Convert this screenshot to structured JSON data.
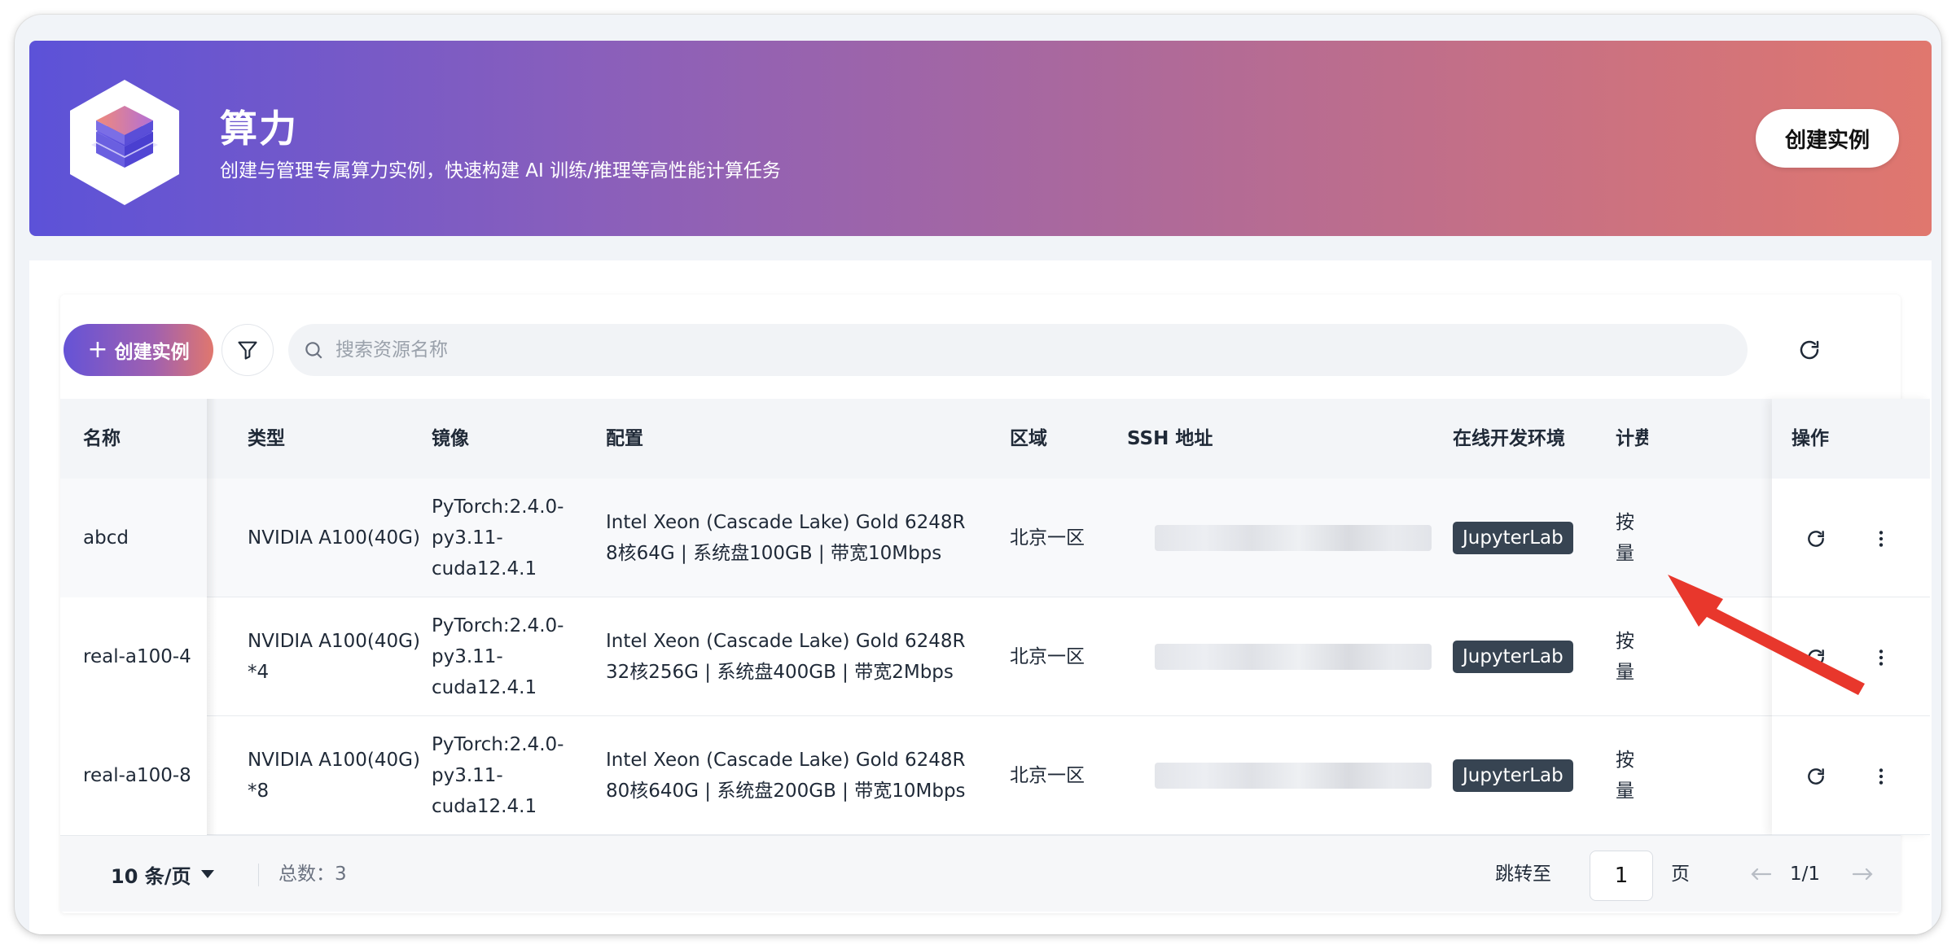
{
  "banner": {
    "title": "算力",
    "subtitle": "创建与管理专属算力实例，快速构建 AI 训练/推理等高性能计算任务",
    "create_button": "创建实例",
    "logo_icon": "server-stack-icon"
  },
  "toolbar": {
    "create_button": "创建实例",
    "search_placeholder": "搜索资源名称",
    "icons": [
      "plus-icon",
      "filter-icon",
      "search-icon",
      "refresh-icon"
    ]
  },
  "table": {
    "columns": [
      "名称",
      "类型",
      "镜像",
      "配置",
      "区域",
      "SSH 地址",
      "在线开发环境",
      "计费",
      "操作"
    ],
    "rows": [
      {
        "name": "abcd",
        "type": "NVIDIA A100(40G)",
        "image": [
          "PyTorch:2.4.0-",
          "py3.11-",
          "cuda12.4.1"
        ],
        "config": [
          "Intel Xeon (Cascade Lake) Gold 6248R",
          "8核64G | 系统盘100GB | 带宽10Mbps"
        ],
        "region": "北京一区",
        "dev_env": "JupyterLab",
        "billing": "按量"
      },
      {
        "name": "real-a100-4",
        "type": "NVIDIA A100(40G) *4",
        "image": [
          "PyTorch:2.4.0-",
          "py3.11-",
          "cuda12.4.1"
        ],
        "config": [
          "Intel Xeon (Cascade Lake) Gold 6248R",
          "32核256G | 系统盘400GB | 带宽2Mbps"
        ],
        "region": "北京一区",
        "dev_env": "JupyterLab",
        "billing": "按量"
      },
      {
        "name": "real-a100-8",
        "type": "NVIDIA A100(40G) *8",
        "image": [
          "PyTorch:2.4.0-",
          "py3.11-",
          "cuda12.4.1"
        ],
        "config": [
          "Intel Xeon (Cascade Lake) Gold 6248R",
          "80核640G | 系统盘200GB | 带宽10Mbps"
        ],
        "region": "北京一区",
        "dev_env": "JupyterLab",
        "billing": "按量"
      }
    ]
  },
  "footer": {
    "page_size": "10 条/页",
    "total_label": "总数：3",
    "jump_label": "跳转至",
    "page_input": "1",
    "page_unit": "页",
    "page_indicator": "1/1"
  },
  "colors": {
    "banner_start": "#5c52d8",
    "banner_end": "#e0776e",
    "badge_bg": "#374452",
    "annotation_arrow": "#e8372c"
  }
}
